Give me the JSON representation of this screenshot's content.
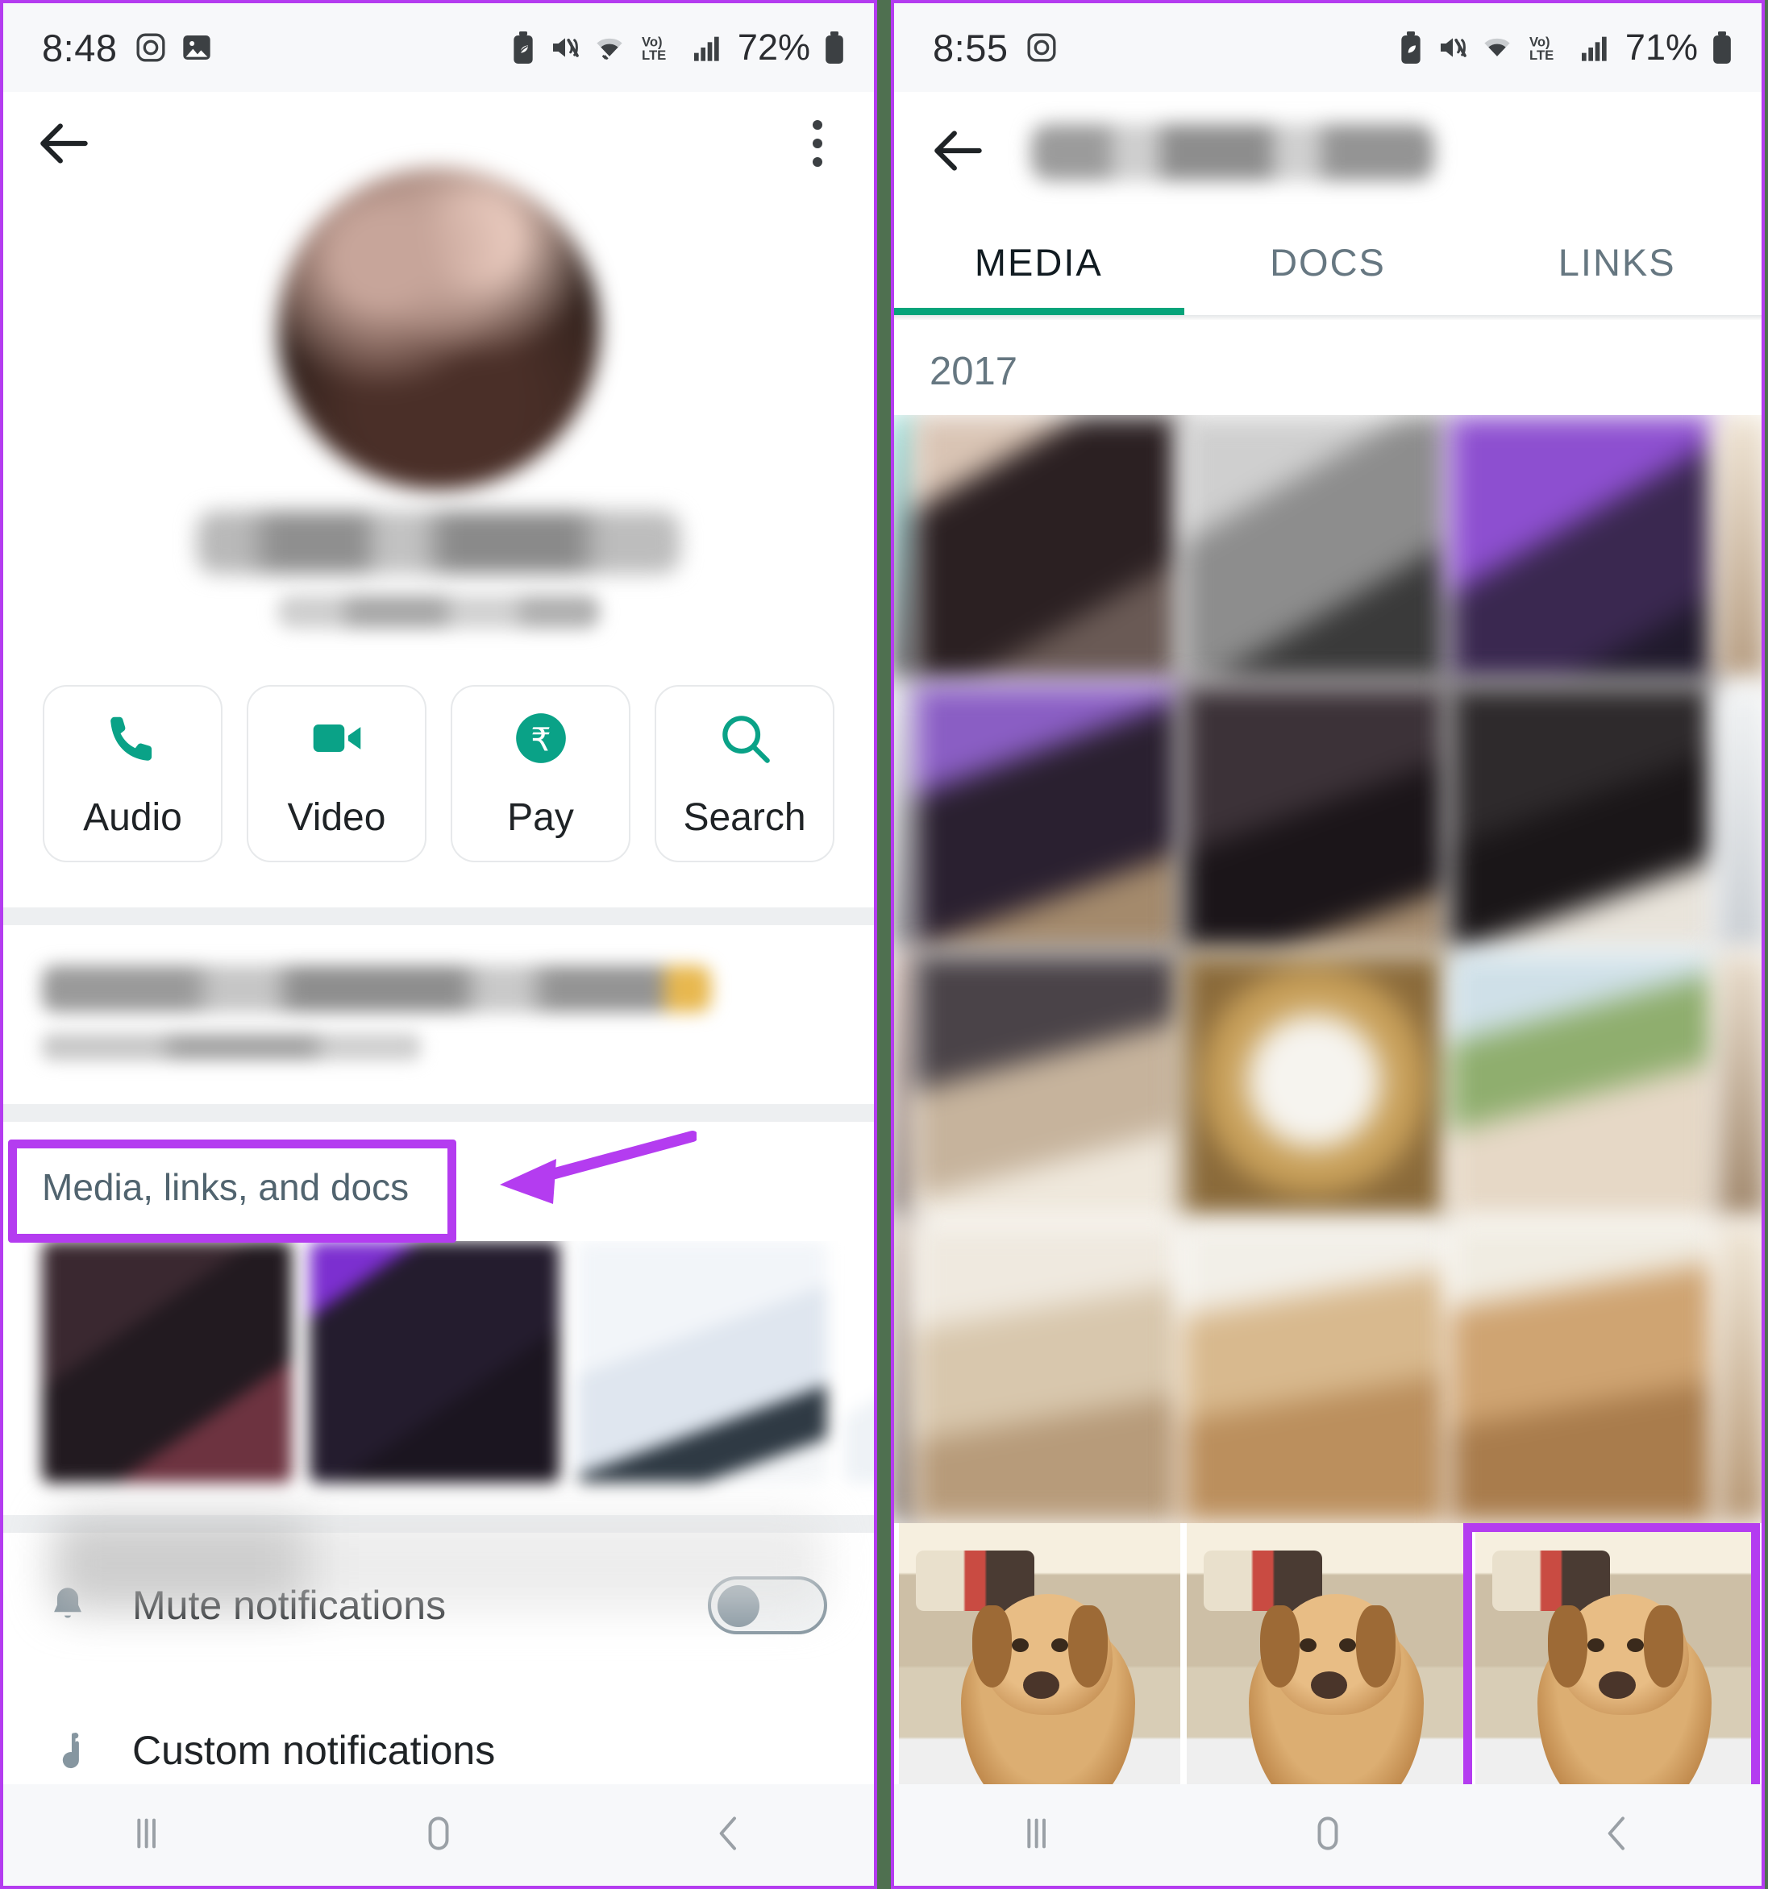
{
  "left_phone": {
    "status_bar": {
      "time": "8:48",
      "battery_percent": "72%",
      "icons": [
        "instagram-icon",
        "image-icon",
        "battery-saver-icon",
        "mute-icon",
        "wifi-icon",
        "volte-icon",
        "signal-icon",
        "battery-icon"
      ]
    },
    "top_bar": {
      "back_icon": "back-arrow-icon",
      "overflow_icon": "kebab-menu-icon"
    },
    "profile": {
      "avatar": "contact-avatar",
      "name": "",
      "phone_number": ""
    },
    "actions": [
      {
        "label": "Audio",
        "icon": "phone-icon"
      },
      {
        "label": "Video",
        "icon": "video-camera-icon"
      },
      {
        "label": "Pay",
        "icon": "rupee-pay-icon"
      },
      {
        "label": "Search",
        "icon": "search-icon"
      }
    ],
    "message_card": {
      "text": "",
      "date": ""
    },
    "media_section": {
      "label": "Media, links, and docs",
      "highlighted": true,
      "thumbnails": [
        "thumb-1",
        "thumb-2",
        "thumb-3",
        "thumb-4"
      ]
    },
    "settings_rows": [
      {
        "label": "Mute notifications",
        "icon": "bell-icon",
        "toggle": "off"
      },
      {
        "label": "Custom notifications",
        "icon": "music-note-icon",
        "toggle": null
      }
    ],
    "nav_bar": [
      "recents-icon",
      "home-icon",
      "back-icon"
    ]
  },
  "right_phone": {
    "status_bar": {
      "time": "8:55",
      "battery_percent": "71%",
      "icons": [
        "instagram-icon",
        "battery-saver-icon",
        "mute-icon",
        "wifi-icon",
        "volte-icon",
        "signal-icon",
        "battery-icon"
      ]
    },
    "top_bar": {
      "back_icon": "back-arrow-icon",
      "title": ""
    },
    "tabs": [
      {
        "label": "MEDIA",
        "active": true
      },
      {
        "label": "DOCS",
        "active": false
      },
      {
        "label": "LINKS",
        "active": false
      }
    ],
    "year_header": "2017",
    "media_grid_rows": 4,
    "dog_photos": [
      {
        "name": "dog-photo-1",
        "highlighted": false
      },
      {
        "name": "dog-photo-2",
        "highlighted": false
      },
      {
        "name": "dog-photo-3",
        "highlighted": true
      }
    ],
    "nav_bar": [
      "recents-icon",
      "home-icon",
      "back-icon"
    ]
  },
  "colors": {
    "accent_teal": "#06a47a",
    "highlight_purple": "#b43cf0",
    "status_bar_bg": "#f7f8fa",
    "secondary_text": "#667781",
    "divider_green": "#4f7050"
  }
}
